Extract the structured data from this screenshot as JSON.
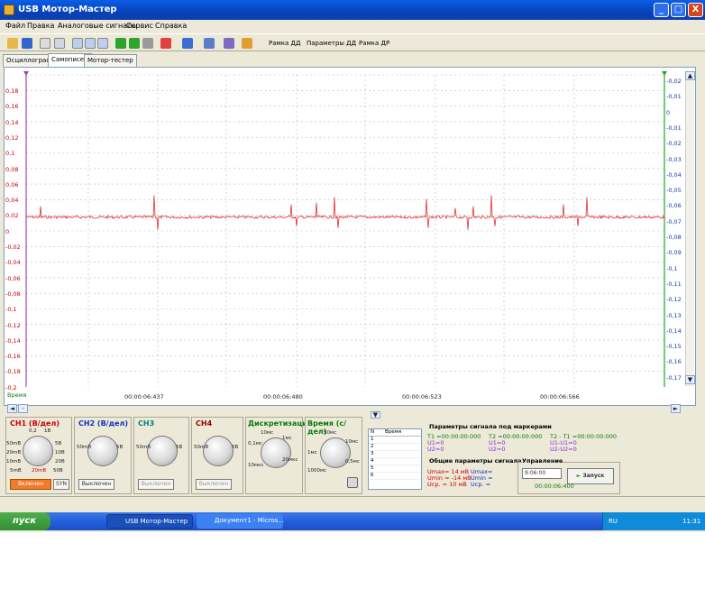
{
  "window": {
    "title": "USB Мотор-Мастер",
    "minimize": "_",
    "maximize": "□",
    "close": "X"
  },
  "menu": [
    "Файл",
    "Правка",
    "Аналоговые сигналы",
    "Сервис",
    "Справка"
  ],
  "toolbar": {
    "btn1": "Рамка ДД",
    "btn2": "Параметры ДД",
    "btn3": "Рамка ДР"
  },
  "tabs": [
    "Осциллограф",
    "Самописец",
    "Мотор-тестер"
  ],
  "plot": {
    "y_left": [
      "0,18",
      "0,16",
      "0,14",
      "0,12",
      "0,1",
      "0,08",
      "0,06",
      "0,04",
      "0,02",
      "0",
      "-0,02",
      "-0,04",
      "-0,06",
      "-0,08",
      "-0,1",
      "-0,12",
      "-0,14",
      "-0,16",
      "-0,18",
      "-0,2"
    ],
    "y_right": [
      "-0,02",
      "-0,01",
      "0",
      "-0,01",
      "-0,02",
      "-0,03",
      "-0,04",
      "-0,05",
      "-0,06",
      "-0,07",
      "-0,08",
      "-0,09",
      "-0,1",
      "-0,11",
      "-0,12",
      "-0,13",
      "-0,14",
      "-0,15",
      "-0,16",
      "-0,17"
    ],
    "time_label": "Время",
    "x_ticks": [
      "00:00:06:437",
      "00:00:06:480",
      "00:00:06:523",
      "00:00:06:566"
    ],
    "trace_color": "#e03030"
  },
  "channels": [
    {
      "label": "CH1 (В/дел)",
      "color": "#cc0000",
      "value": "20mВ",
      "button": "Включен",
      "sync": "SYN"
    },
    {
      "label": "CH2 (В/дел)",
      "color": "#1030c0",
      "button": "Выключен"
    },
    {
      "label": "CH3",
      "color": "#008080",
      "button": "Выключен"
    },
    {
      "label": "CH4",
      "color": "#9a0000",
      "button": "Выключен"
    }
  ],
  "knob_ticks": {
    "top": "0,2",
    "top2": "1В",
    "left1": "50mВ",
    "left2": "20mВ",
    "left3": "10mВ",
    "left4": "5mВ",
    "right1": "5В",
    "right2": "10В",
    "right3": "20В",
    "right4": "50В"
  },
  "sampling": {
    "label": "Дискретизация",
    "t1": "10мс",
    "t2": "1мс",
    "t3": "0,1мс",
    "t4": "10мкс",
    "t5": "50мс",
    "t6": "20мкс"
  },
  "time_div": {
    "label": "Время (с/дел)",
    "t1": "50мс",
    "t2": "10мс",
    "t3": "1мс",
    "t4": "0,5мс",
    "t5": "5мс",
    "t6": "1000мс"
  },
  "table": {
    "col1": "N",
    "col2": "Время",
    "rows": [
      "1",
      "2",
      "3",
      "4",
      "5",
      "6"
    ]
  },
  "markers": {
    "title": "Параметры сигнала под маркерами",
    "t1": "T1 =00:00:00:000",
    "t2": "T2 =00:00:00:000",
    "dt": "T2 - T1 =00:00:00:000",
    "u1a": "U1=0",
    "u1b": "U2=0",
    "u2a": "U1=0",
    "u2b": "U2=0",
    "ua": "U1-U1=0",
    "ub": "U2-U2=0",
    "general": "Общие параметры сигнала",
    "umax": "Umax= 14 мВ",
    "umin": "Umin = -14 мВ",
    "ucp": "Ucp. = 10 мВ",
    "umax2": "Umax=",
    "umin2": "Umin =",
    "ucp2": "Ucp. ="
  },
  "control": {
    "label": "Управление",
    "time": "9:06:00",
    "elapsed": "00:00:06:400",
    "start": "Запуск"
  },
  "taskbar": {
    "start": "пуск",
    "task1": "USB Мотор-Мастер",
    "task2": "Документ1 - Micros...",
    "lang": "RU",
    "clock": "11:31"
  }
}
